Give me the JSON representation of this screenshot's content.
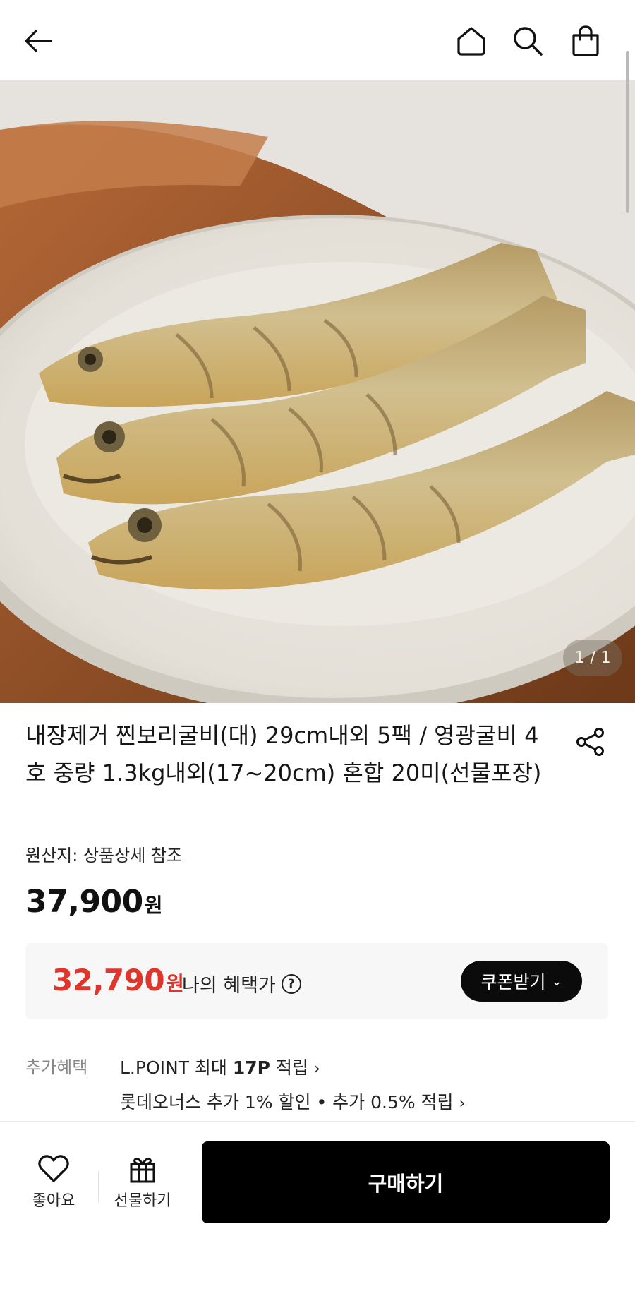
{
  "header": {
    "back_icon": "arrow-left-icon",
    "home_icon": "home-icon",
    "search_icon": "search-icon",
    "cart_icon": "shopping-bag-icon"
  },
  "gallery": {
    "counter": "1 / 1",
    "image_subject": "steamed yellow croaker fish on a white oval plate on a wooden board"
  },
  "product": {
    "title": "내장제거 찐보리굴비(대) 29cm내외 5팩 / 영광굴비 4호 중량 1.3kg내외(17~20cm) 혼합 20미(선물포장)",
    "origin": "원산지: 상품상세 참조",
    "price": "37,900",
    "price_unit": "원",
    "share_icon": "share-icon"
  },
  "benefit": {
    "price": "32,790",
    "price_unit": "원",
    "label": "나의 혜택가",
    "help_icon": "question-circle-icon",
    "coupon_button": "쿠폰받기",
    "price_color": "#e0352b"
  },
  "extra": {
    "label": "추가혜택",
    "line1_prefix": "L.POINT 최대 ",
    "line1_bold": "17P",
    "line1_suffix": " 적립",
    "line2": "롯데오너스 추가 1% 할인 • 추가 0.5% 적립"
  },
  "bottom_bar": {
    "like_label": "좋아요",
    "gift_label": "선물하기",
    "buy_label": "구매하기"
  }
}
